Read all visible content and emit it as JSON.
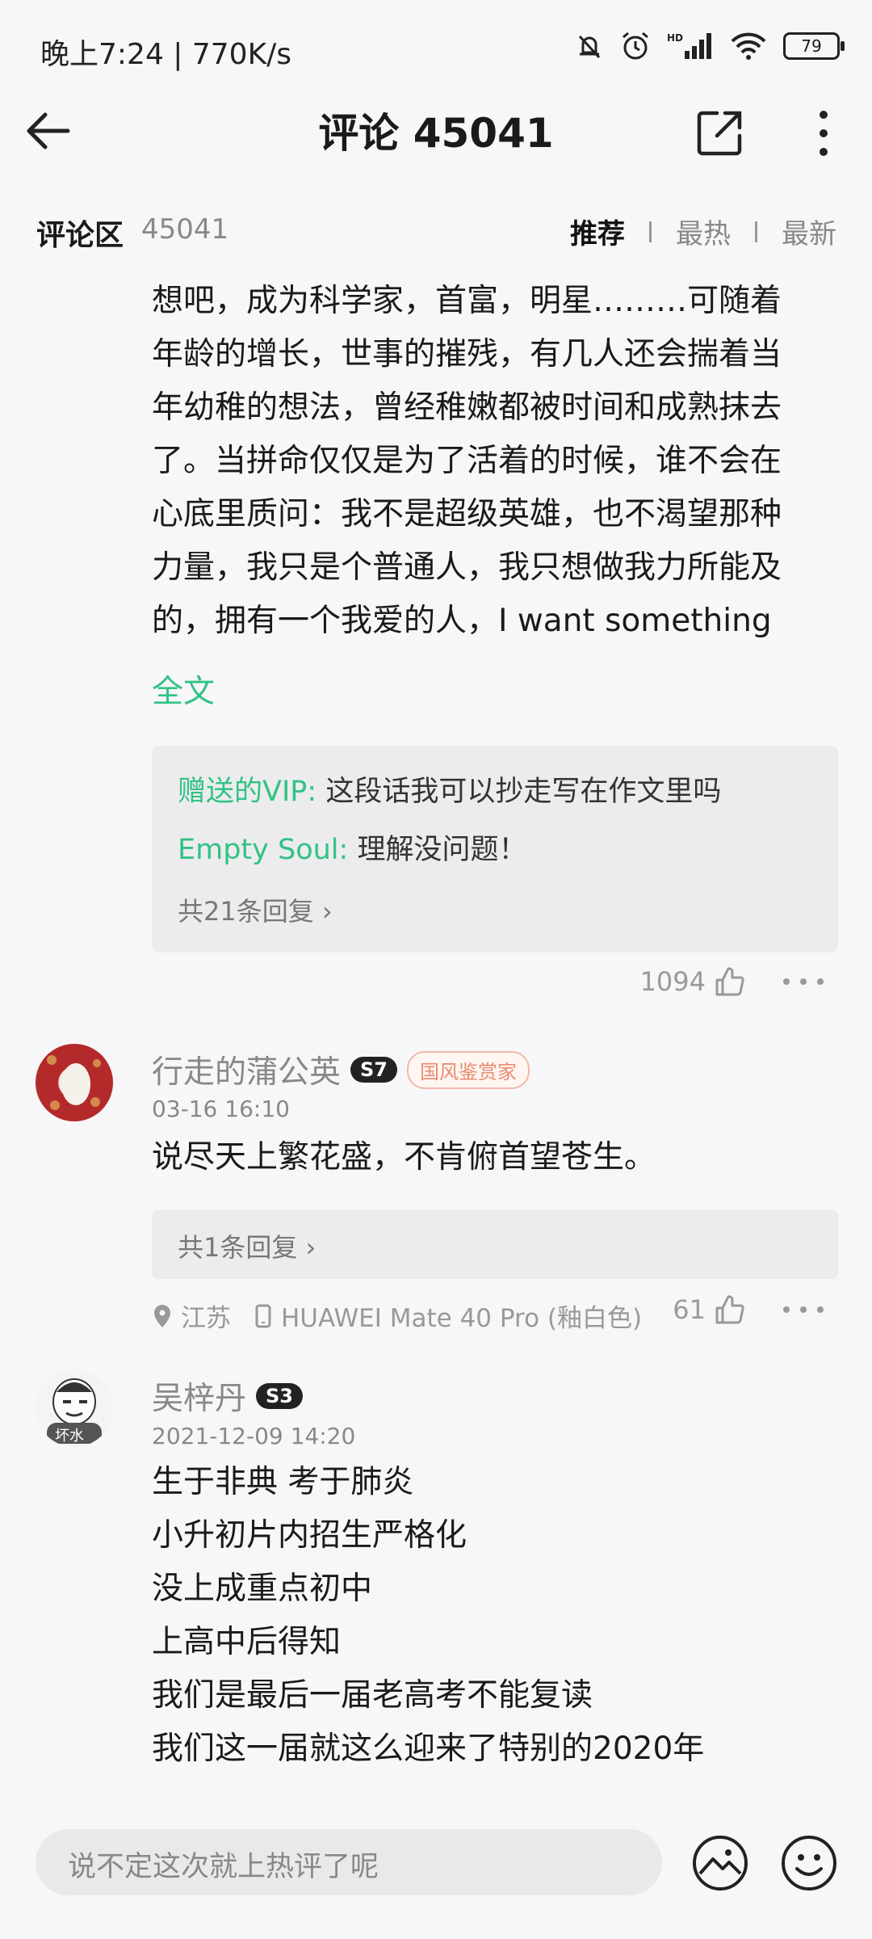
{
  "status_bar": {
    "time": "晚上7:24 | 770K/s",
    "battery": "79",
    "icons": [
      "mute-bell-icon",
      "alarm-icon",
      "hd-signal-icon",
      "wifi-icon",
      "battery-icon"
    ]
  },
  "header": {
    "title": "评论 45041",
    "back_icon": "back-arrow-icon",
    "share_icon": "share-icon",
    "more_icon": "more-vertical-icon"
  },
  "comment_section": {
    "title": "评论区",
    "count": "45041",
    "sort_tabs": [
      "推荐",
      "最热",
      "最新"
    ],
    "active_tab": "推荐"
  },
  "comments": [
    {
      "text_lines": [
        "想吧，成为科学家，首富，明星………可随着",
        "年龄的增长，世事的摧残，有几人还会揣着当",
        "年幼稚的想法，曾经稚嫩都被时间和成熟抹去",
        "了。当拼命仅仅是为了活着的时候，谁不会在",
        "心底里质问：我不是超级英雄，也不渴望那种",
        "力量，我只是个普通人，我只想做我力所能及",
        "的，拥有一个我爱的人，I want something"
      ],
      "full_text_label": "全文",
      "replies": [
        {
          "user": "赠送的VIP:",
          "text": "这段话我可以抄走写在作文里吗"
        },
        {
          "user": "Empty Soul:",
          "text": "理解没问题！"
        }
      ],
      "reply_count_label": "共21条回复 ›",
      "likes": "1094"
    },
    {
      "username": "行走的蒲公英",
      "level": "S7",
      "fan_badge": "国风鉴赏家",
      "date": "03-16 16:10",
      "text": "说尽天上繁花盛，不肯俯首望苍生。",
      "reply_count_label": "共1条回复 ›",
      "location": "江苏",
      "device": "HUAWEI Mate 40 Pro (釉白色)",
      "likes": "61"
    },
    {
      "username": "吴梓丹",
      "level": "S3",
      "avatar_text": "坏水",
      "date": "2021-12-09 14:20",
      "text_lines": [
        "生于非典 考于肺炎",
        "小升初片内招生严格化",
        "没上成重点初中",
        "上高中后得知",
        "我们是最后一届老高考不能复读",
        "我们这一届就这么迎来了特别的2020年"
      ]
    }
  ],
  "bottom_bar": {
    "input_placeholder": "说不定这次就上热评了呢",
    "image_icon": "image-icon",
    "emoji_icon": "emoji-icon"
  },
  "colors": {
    "accent_green": "#32c285",
    "background": "#f7f7f9"
  }
}
